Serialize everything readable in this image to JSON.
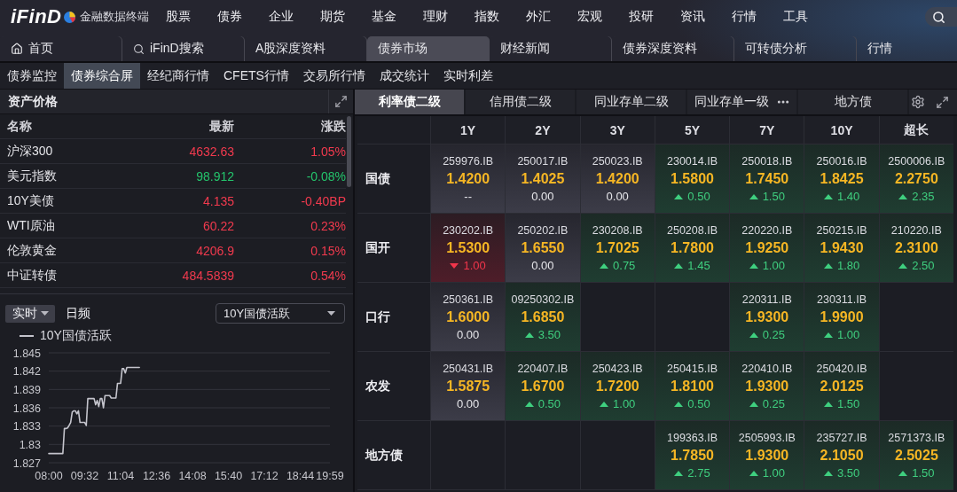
{
  "app": {
    "logo": "iFinD",
    "subtitle": "金融数据终端"
  },
  "main_menu": [
    "股票",
    "债券",
    "企业",
    "期货",
    "基金",
    "理财",
    "指数",
    "外汇",
    "宏观",
    "投研",
    "资讯",
    "行情",
    "工具"
  ],
  "page_tabs": [
    {
      "label": "首页",
      "kind": "home",
      "selected": false
    },
    {
      "label": "iFinD搜索",
      "kind": "search",
      "selected": false
    },
    {
      "label": "A股深度资料",
      "kind": "page",
      "selected": false
    },
    {
      "label": "债券市场",
      "kind": "page",
      "selected": true
    },
    {
      "label": "财经新闻",
      "kind": "page",
      "selected": false
    },
    {
      "label": "债券深度资料",
      "kind": "page",
      "selected": false
    },
    {
      "label": "可转债分析",
      "kind": "page",
      "selected": false
    },
    {
      "label": "行情",
      "kind": "page",
      "selected": false
    }
  ],
  "sub_tabs": [
    {
      "label": "债券监控",
      "selected": false
    },
    {
      "label": "债券综合屏",
      "selected": true
    },
    {
      "label": "经纪商行情",
      "selected": false
    },
    {
      "label": "CFETS行情",
      "selected": false
    },
    {
      "label": "交易所行情",
      "selected": false
    },
    {
      "label": "成交统计",
      "selected": false
    },
    {
      "label": "实时利差",
      "selected": false
    }
  ],
  "asset_prices": {
    "title": "资产价格",
    "columns": [
      "名称",
      "最新",
      "涨跌"
    ],
    "rows": [
      {
        "name": "沪深300",
        "latest": "4632.63",
        "change": "1.05%",
        "color": "#f23a4e"
      },
      {
        "name": "美元指数",
        "latest": "98.912",
        "change": "-0.08%",
        "color": "#24c46c"
      },
      {
        "name": "10Y美债",
        "latest": "4.135",
        "change": "-0.40BP",
        "color": "#f23a4e"
      },
      {
        "name": "WTI原油",
        "latest": "60.22",
        "change": "0.23%",
        "color": "#f23a4e"
      },
      {
        "name": "伦敦黄金",
        "latest": "4206.9",
        "change": "0.15%",
        "color": "#f23a4e"
      },
      {
        "name": "中证转债",
        "latest": "484.5839",
        "change": "0.54%",
        "color": "#f23a4e"
      }
    ]
  },
  "chart_panel": {
    "modes": [
      {
        "label": "实时",
        "selected": true,
        "dropdown": true
      },
      {
        "label": "日频",
        "selected": false,
        "dropdown": false
      }
    ],
    "series_select": {
      "value": "10Y国债活跃"
    },
    "chart_data": {
      "type": "line",
      "grid": true,
      "categories": [
        "08:00",
        null,
        null,
        null,
        null,
        null,
        null,
        null,
        null,
        null,
        null,
        null,
        null,
        null,
        null,
        null,
        null,
        null,
        null,
        null,
        null,
        null,
        null,
        "09:32",
        null,
        null,
        null,
        null,
        null,
        null,
        null,
        null,
        null,
        null,
        null,
        null,
        null,
        null,
        null,
        null,
        null,
        null,
        null,
        null,
        null,
        null,
        "11:04",
        null,
        null,
        null,
        null,
        null,
        null,
        null,
        null,
        null,
        null,
        null,
        null,
        null,
        null,
        null,
        null,
        null,
        null,
        null,
        null,
        null,
        null,
        "12:36",
        null,
        null,
        null,
        null,
        null,
        null,
        null,
        null,
        null,
        null,
        null,
        null,
        null,
        null,
        null,
        null,
        null,
        null,
        null,
        null,
        null,
        null,
        "14:08",
        null,
        null,
        null,
        null,
        null,
        null,
        null,
        null,
        null,
        null,
        null,
        null,
        null,
        null,
        null,
        null,
        null,
        null,
        null,
        null,
        null,
        null,
        "15:40",
        null,
        null,
        null,
        null,
        null,
        null,
        null,
        null,
        null,
        null,
        null,
        null,
        null,
        null,
        null,
        null,
        null,
        null,
        null,
        null,
        null,
        null,
        "17:12",
        null,
        null,
        null,
        null,
        null,
        null,
        null,
        null,
        null,
        null,
        null,
        null,
        null,
        null,
        null,
        null,
        null,
        null,
        null,
        null,
        null,
        null,
        "18:44",
        null,
        null,
        null,
        null,
        null,
        null,
        null,
        null,
        null,
        null,
        null,
        null,
        null,
        null,
        null,
        null,
        null,
        null,
        "19:59"
      ],
      "series": [
        {
          "name": "10Y国债活跃",
          "color": "#c4c4cc",
          "values": [
            1.8285,
            1.8285,
            1.8285,
            1.8285,
            1.8285,
            1.8285,
            1.8285,
            1.8285,
            1.8285,
            1.8285,
            1.8326,
            1.8326,
            1.8327,
            1.8331,
            1.8336,
            1.8353,
            1.8355,
            1.8355,
            1.835,
            1.8355,
            1.8336,
            1.8336,
            1.8336,
            1.8336,
            1.8331,
            1.8375,
            1.8375,
            1.8375,
            1.8375,
            1.8375,
            1.8365,
            1.8372,
            1.8362,
            1.8375,
            1.8375,
            1.836,
            1.838,
            1.838,
            1.838,
            1.838,
            1.8376,
            1.8376,
            1.8376,
            1.8376,
            1.84,
            1.84,
            1.84,
            1.8424,
            1.8424,
            1.8417,
            1.8426,
            1.8426,
            1.8426,
            1.8426,
            1.8426,
            1.8426,
            1.8426,
            1.8426,
            1.8426,
            null,
            null,
            null,
            null,
            null,
            null,
            null,
            null,
            null,
            null,
            null,
            null,
            null,
            null,
            null,
            null,
            null,
            null,
            null,
            null,
            null,
            null,
            null,
            null,
            null,
            null,
            null,
            null,
            null,
            null,
            null,
            null,
            null,
            null,
            null,
            null,
            null,
            null,
            null,
            null,
            null,
            null,
            null,
            null,
            null,
            null,
            null,
            null,
            null,
            null,
            null,
            null,
            null,
            null,
            null,
            null,
            null,
            null,
            null,
            null,
            null,
            null,
            null,
            null,
            null,
            null,
            null,
            null,
            null,
            null,
            null,
            null,
            null,
            null,
            null,
            null,
            null,
            null,
            null,
            null,
            null,
            null,
            null,
            null,
            null,
            null,
            null,
            null,
            null,
            null,
            null,
            null,
            null,
            null,
            null,
            null,
            null,
            null,
            null,
            null,
            null,
            null,
            null,
            null,
            null,
            null,
            null,
            null,
            null,
            null,
            null,
            null,
            null,
            null,
            null,
            null,
            null,
            null,
            null,
            null,
            null,
            null
          ]
        }
      ],
      "ylim": [
        1.827,
        1.845
      ],
      "yticks": [
        1.845,
        1.842,
        1.839,
        1.836,
        1.833,
        1.83,
        1.827
      ]
    }
  },
  "bond_panel": {
    "tabs": [
      {
        "label": "利率债二级",
        "selected": true,
        "more": false
      },
      {
        "label": "信用债二级",
        "selected": false,
        "more": false
      },
      {
        "label": "同业存单二级",
        "selected": false,
        "more": false
      },
      {
        "label": "同业存单一级",
        "selected": false,
        "more": true
      },
      {
        "label": "地方债",
        "selected": false,
        "more": false
      }
    ],
    "columns": [
      "1Y",
      "2Y",
      "3Y",
      "5Y",
      "7Y",
      "10Y",
      "超长"
    ],
    "rows": [
      {
        "label": "国债",
        "cells": [
          {
            "code": "259976.IB",
            "yield": "1.4200",
            "change": "--",
            "kind": "flat"
          },
          {
            "code": "250017.IB",
            "yield": "1.4025",
            "change": "0.00",
            "kind": "flat"
          },
          {
            "code": "250023.IB",
            "yield": "1.4200",
            "change": "0.00",
            "kind": "flat"
          },
          {
            "code": "230014.IB",
            "yield": "1.5800",
            "change": "0.50",
            "kind": "up"
          },
          {
            "code": "250018.IB",
            "yield": "1.7450",
            "change": "1.50",
            "kind": "up"
          },
          {
            "code": "250016.IB",
            "yield": "1.8425",
            "change": "1.40",
            "kind": "up"
          },
          {
            "code": "2500006.IB",
            "yield": "2.2750",
            "change": "2.35",
            "kind": "up"
          }
        ]
      },
      {
        "label": "国开",
        "cells": [
          {
            "code": "230202.IB",
            "yield": "1.5300",
            "change": "1.00",
            "kind": "down"
          },
          {
            "code": "250202.IB",
            "yield": "1.6550",
            "change": "0.00",
            "kind": "flat"
          },
          {
            "code": "230208.IB",
            "yield": "1.7025",
            "change": "0.75",
            "kind": "up"
          },
          {
            "code": "250208.IB",
            "yield": "1.7800",
            "change": "1.45",
            "kind": "up"
          },
          {
            "code": "220220.IB",
            "yield": "1.9250",
            "change": "1.00",
            "kind": "up"
          },
          {
            "code": "250215.IB",
            "yield": "1.9430",
            "change": "1.80",
            "kind": "up"
          },
          {
            "code": "210220.IB",
            "yield": "2.3100",
            "change": "2.50",
            "kind": "up"
          }
        ]
      },
      {
        "label": "口行",
        "cells": [
          {
            "code": "250361.IB",
            "yield": "1.6000",
            "change": "0.00",
            "kind": "flat"
          },
          {
            "code": "09250302.IB",
            "yield": "1.6850",
            "change": "3.50",
            "kind": "up"
          },
          null,
          null,
          {
            "code": "220311.IB",
            "yield": "1.9300",
            "change": "0.25",
            "kind": "up"
          },
          {
            "code": "230311.IB",
            "yield": "1.9900",
            "change": "1.00",
            "kind": "up"
          },
          null
        ]
      },
      {
        "label": "农发",
        "cells": [
          {
            "code": "250431.IB",
            "yield": "1.5875",
            "change": "0.00",
            "kind": "flat"
          },
          {
            "code": "220407.IB",
            "yield": "1.6700",
            "change": "0.50",
            "kind": "up"
          },
          {
            "code": "250423.IB",
            "yield": "1.7200",
            "change": "1.00",
            "kind": "up"
          },
          {
            "code": "250415.IB",
            "yield": "1.8100",
            "change": "0.50",
            "kind": "up"
          },
          {
            "code": "220410.IB",
            "yield": "1.9300",
            "change": "0.25",
            "kind": "up"
          },
          {
            "code": "250420.IB",
            "yield": "2.0125",
            "change": "1.50",
            "kind": "up"
          },
          null
        ]
      },
      {
        "label": "地方债",
        "cells": [
          null,
          null,
          null,
          {
            "code": "199363.IB",
            "yield": "1.7850",
            "change": "2.75",
            "kind": "up"
          },
          {
            "code": "2505993.IB",
            "yield": "1.9300",
            "change": "1.00",
            "kind": "up"
          },
          {
            "code": "235727.IB",
            "yield": "2.1050",
            "change": "3.50",
            "kind": "up"
          },
          {
            "code": "2571373.IB",
            "yield": "2.5025",
            "change": "1.50",
            "kind": "up"
          }
        ]
      }
    ]
  }
}
